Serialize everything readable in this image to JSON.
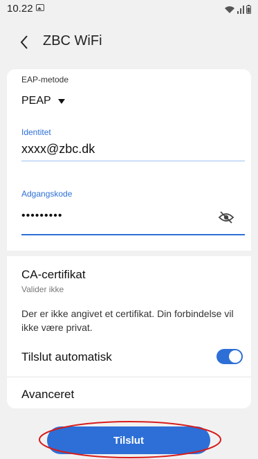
{
  "status_bar": {
    "time": "10.22",
    "icons": [
      "image-icon",
      "wifi-icon",
      "signal-icon",
      "battery-icon"
    ]
  },
  "header": {
    "back_icon": "back-chevron-icon",
    "title": "ZBC WiFi"
  },
  "form": {
    "eap_method": {
      "label": "EAP-metode",
      "value": "PEAP"
    },
    "identity": {
      "label": "Identitet",
      "value": "xxxx@zbc.dk"
    },
    "password": {
      "label": "Adgangskode",
      "value": "•••••••••",
      "visibility_icon": "eye-off-icon"
    },
    "ca_certificate": {
      "title": "CA-certifikat",
      "subtitle": "Valider ikke",
      "warning": "Der er ikke angivet et certifikat. Din forbindelse vil ikke være privat."
    },
    "auto_connect": {
      "label": "Tilslut automatisk",
      "enabled": true
    },
    "advanced": {
      "label": "Avanceret"
    }
  },
  "actions": {
    "connect_label": "Tilslut"
  },
  "colors": {
    "accent": "#2d6fd6",
    "background": "#f1f1f1",
    "card": "#ffffff",
    "annotation": "#d81b1b"
  }
}
